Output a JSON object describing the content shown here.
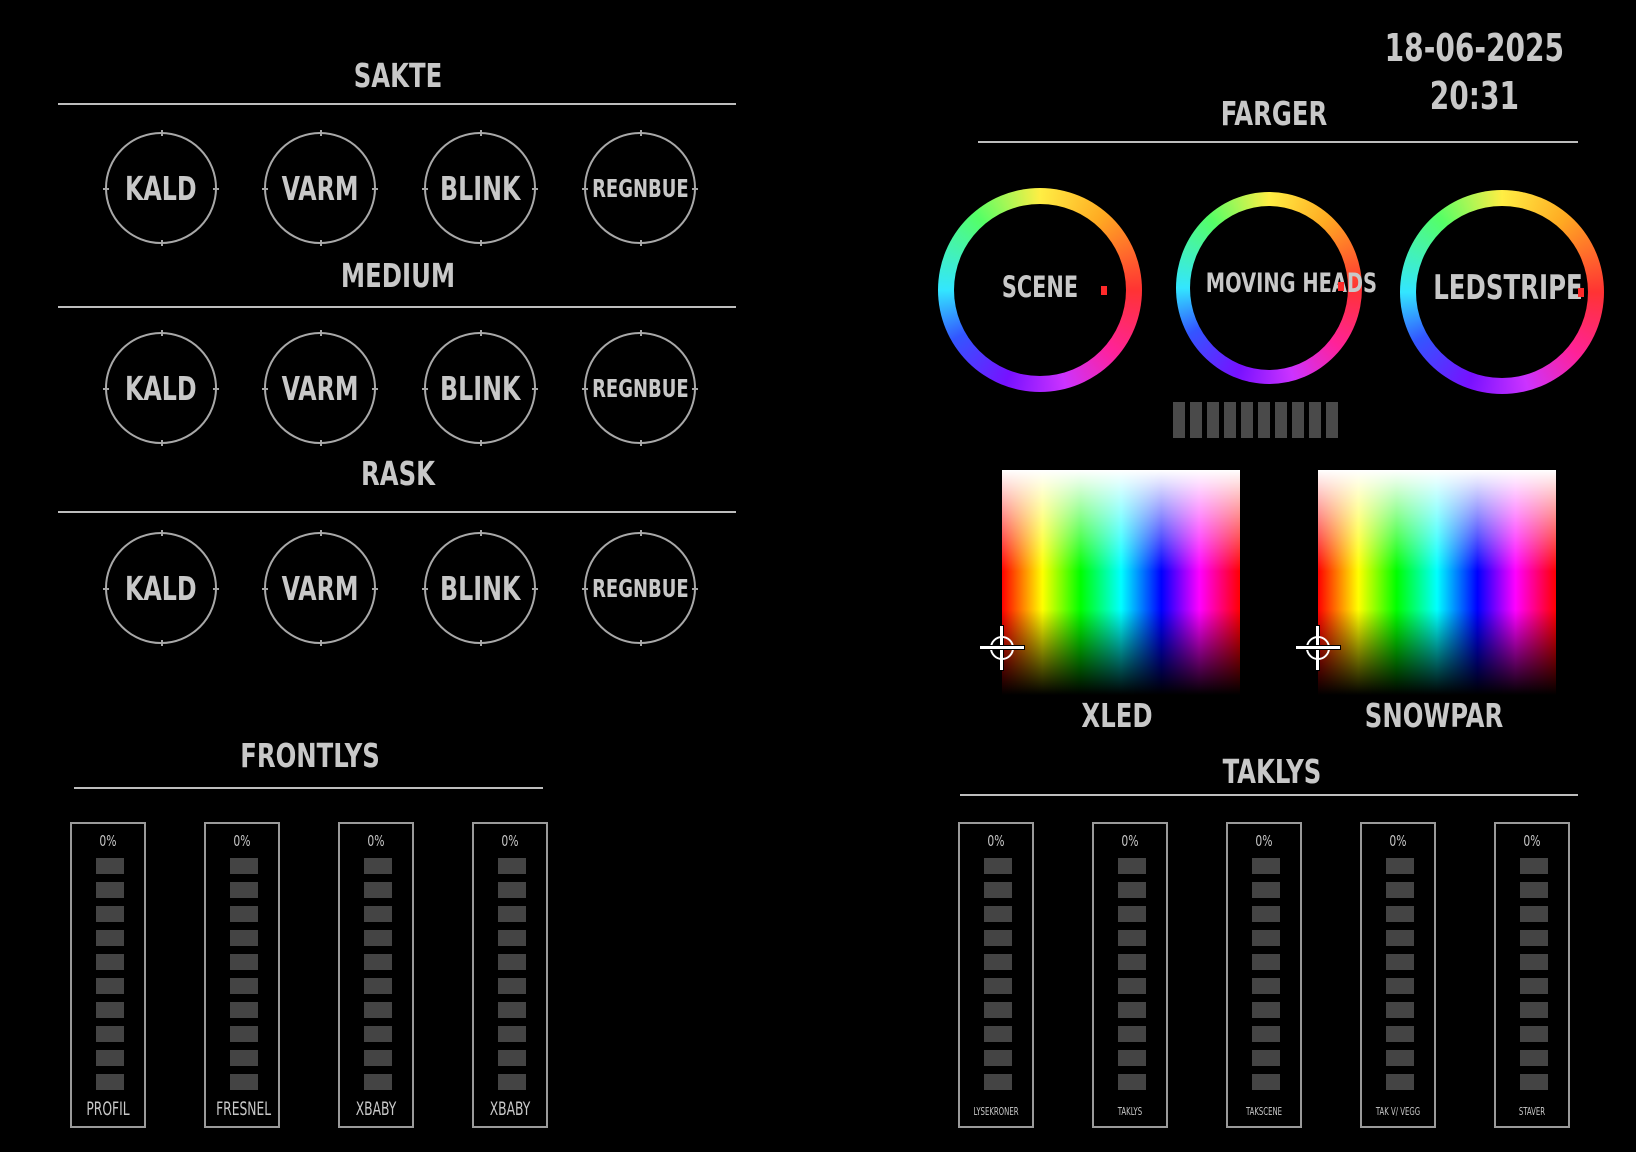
{
  "clock": {
    "date": "18-06-2025",
    "time": "20:31"
  },
  "effects": {
    "groups": [
      {
        "title": "SAKTE",
        "buttons": [
          "KALD",
          "VARM",
          "BLINK",
          "REGNBUE"
        ]
      },
      {
        "title": "MEDIUM",
        "buttons": [
          "KALD",
          "VARM",
          "BLINK",
          "REGNBUE"
        ]
      },
      {
        "title": "RASK",
        "buttons": [
          "KALD",
          "VARM",
          "BLINK",
          "REGNBUE"
        ]
      }
    ]
  },
  "colors": {
    "title": "FARGER",
    "wheels": [
      "SCENE",
      "MOVING HEADS",
      "LEDSTRIPE"
    ],
    "pickers": [
      "XLED",
      "SNOWPAR"
    ]
  },
  "frontlys": {
    "title": "FRONTLYS",
    "faders": [
      {
        "label": "PROFIL",
        "value": "0%"
      },
      {
        "label": "FRESNEL",
        "value": "0%"
      },
      {
        "label": "XBABY",
        "value": "0%"
      },
      {
        "label": "XBABY",
        "value": "0%"
      }
    ]
  },
  "taklys": {
    "title": "TAKLYS",
    "faders": [
      {
        "label": "LYSEKRONER",
        "value": "0%"
      },
      {
        "label": "TAKLYS",
        "value": "0%"
      },
      {
        "label": "TAKSCENE",
        "value": "0%"
      },
      {
        "label": "TAK V/ VEGG",
        "value": "0%"
      },
      {
        "label": "STAVER",
        "value": "0%"
      }
    ]
  },
  "style": {
    "background": "#000000",
    "text": "#c8c8c8",
    "segment_off": "#444444"
  }
}
